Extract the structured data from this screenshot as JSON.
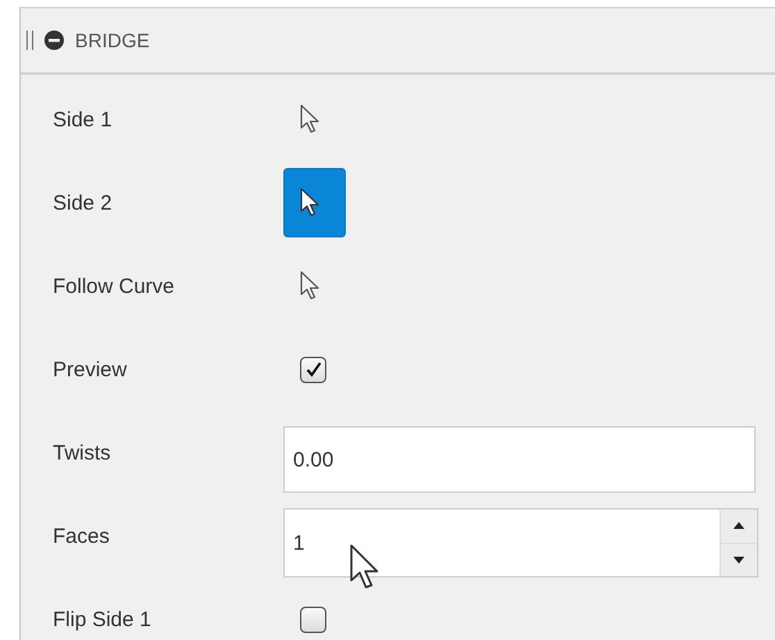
{
  "panel": {
    "title": "BRIDGE",
    "expanded": true
  },
  "rows": [
    {
      "label": "Side 1",
      "kind": "selector",
      "selected": false
    },
    {
      "label": "Side 2",
      "kind": "selector",
      "selected": true
    },
    {
      "label": "Follow Curve",
      "kind": "selector",
      "selected": false
    },
    {
      "label": "Preview",
      "kind": "checkbox",
      "checked": true
    },
    {
      "label": "Twists",
      "kind": "number",
      "value": "0.00"
    },
    {
      "label": "Faces",
      "kind": "spinner",
      "value": "1"
    },
    {
      "label": "Flip Side 1",
      "kind": "checkbox",
      "checked": false
    }
  ]
}
